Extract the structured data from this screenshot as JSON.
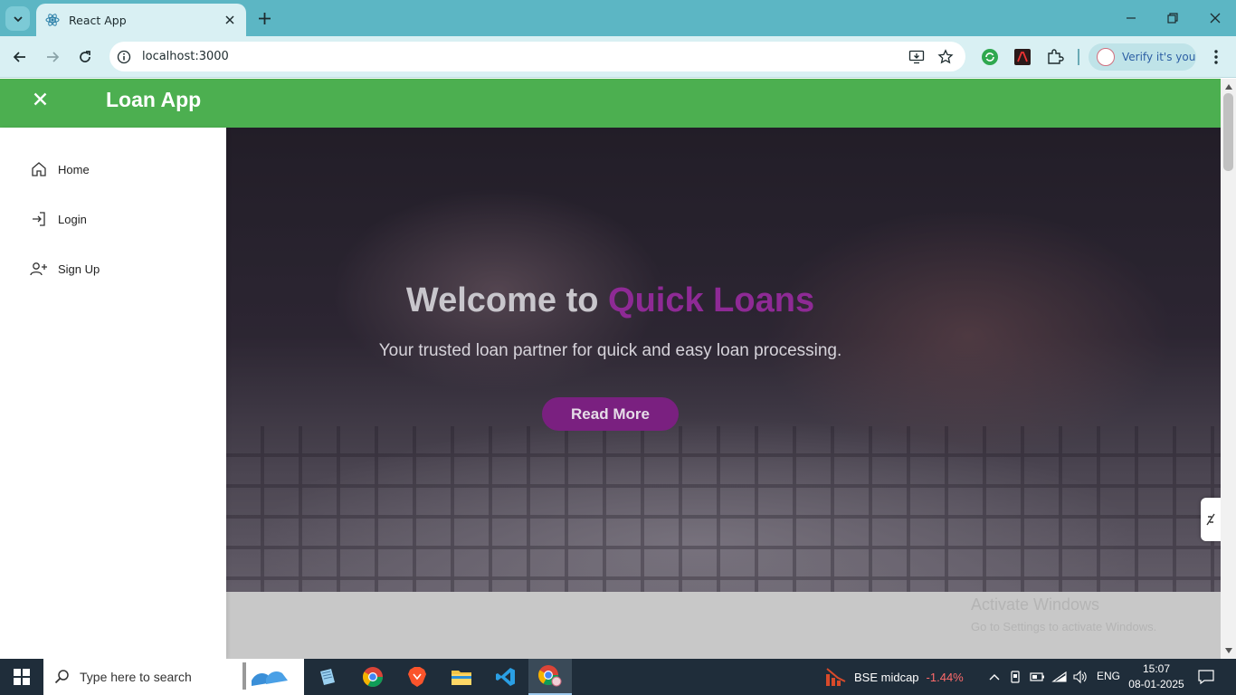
{
  "browser": {
    "tab_title": "React App",
    "url": "localhost:3000",
    "verify_label": "Verify it's you"
  },
  "app": {
    "title": "Loan App",
    "sidebar": {
      "items": [
        {
          "label": "Home",
          "icon": "home-icon"
        },
        {
          "label": "Login",
          "icon": "login-icon"
        },
        {
          "label": "Sign Up",
          "icon": "user-plus-icon"
        }
      ]
    },
    "hero": {
      "title_prefix": "Welcome to ",
      "title_accent": "Quick Loans",
      "subtitle": "Your trusted loan partner for quick and easy loan processing.",
      "button_label": "Read More"
    },
    "colors": {
      "header": "#4caf50",
      "accent": "#8e2a95",
      "button": "#7a2080"
    }
  },
  "watermark": {
    "title": "Activate Windows",
    "subtitle": "Go to Settings to activate Windows."
  },
  "taskbar": {
    "search_placeholder": "Type here to search",
    "widget_name": "BSE midcap",
    "widget_value": "-1.44%",
    "language": "ENG",
    "time": "15:07",
    "date": "08-01-2025"
  }
}
